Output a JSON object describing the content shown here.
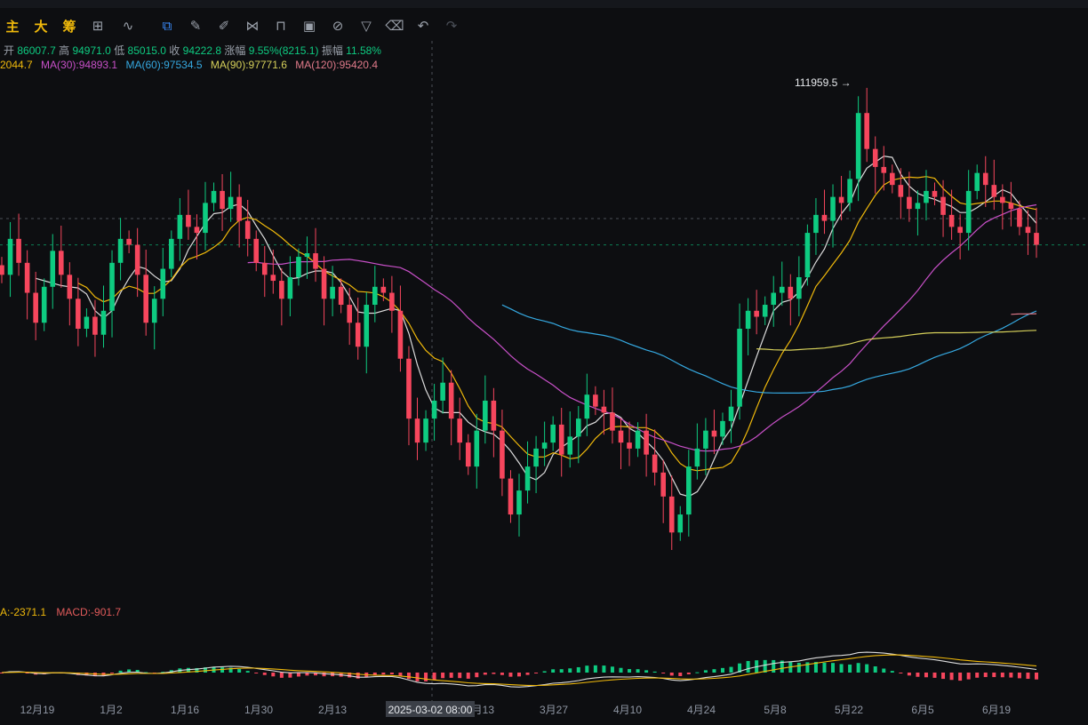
{
  "toolbar": {
    "chars": [
      "主",
      "大",
      "筹"
    ],
    "icons": [
      "candle-type-icon",
      "indicator-icon",
      "compare-icon",
      "draw-icon",
      "ruler-icon",
      "brush-icon",
      "pattern-icon",
      "lock-icon",
      "note-icon",
      "magnet-icon",
      "filter-icon",
      "trash-icon",
      "undo-icon",
      "redo-icon"
    ]
  },
  "ohlc": {
    "open_label": "开",
    "open": "86007.7",
    "high_label": "高",
    "high": "94971.0",
    "low_label": "低",
    "low": "85015.0",
    "close_label": "收",
    "close": "94222.8",
    "change_label": "涨幅",
    "change": "9.55%(8215.1)",
    "amp_label": "振幅",
    "amp": "11.58%"
  },
  "ma_legend": [
    {
      "text": "2044.7",
      "color": "#f0b90b"
    },
    {
      "text": "MA(30):94893.1",
      "color": "#c850c8"
    },
    {
      "text": "MA(60):97534.5",
      "color": "#35a8e0"
    },
    {
      "text": "MA(90):97771.6",
      "color": "#d6d05a"
    },
    {
      "text": "MA(120):95420.4",
      "color": "#e07a8a"
    }
  ],
  "macd_legend": [
    {
      "text": "A:-2371.1",
      "color": "#f0b90b"
    },
    {
      "text": "MACD:-901.7",
      "color": "#e05a5a"
    }
  ],
  "colors": {
    "up": "#0ecb81",
    "down": "#f6465d",
    "price_line": "#0ecb81"
  },
  "chart_data": {
    "type": "candlestick",
    "title": "",
    "x_labels": [
      "12月19",
      "1月2",
      "1月16",
      "1月30",
      "2月13",
      "2月27",
      "3月13",
      "3月27",
      "4月10",
      "4月24",
      "5月8",
      "5月22",
      "6月5",
      "6月19"
    ],
    "crosshair_label": "2025-03-02 08:00",
    "max_annotation": "111959.5",
    "ylim": [
      72000,
      115000
    ],
    "close_series": [
      98000,
      101000,
      99000,
      96500,
      94000,
      97000,
      100000,
      98000,
      96000,
      93500,
      94500,
      93000,
      95000,
      99000,
      101000,
      100500,
      98000,
      94000,
      96000,
      98500,
      101000,
      103000,
      102000,
      101500,
      104000,
      105000,
      103500,
      104500,
      102500,
      101000,
      99000,
      98000,
      97500,
      96000,
      97800,
      99500,
      99800,
      98500,
      96000,
      97000,
      95500,
      94000,
      92000,
      95500,
      97000,
      96500,
      95000,
      91000,
      86000,
      84000,
      86000,
      87500,
      89000,
      86000,
      84000,
      82000,
      85000,
      87500,
      85000,
      81000,
      78000,
      80000,
      82000,
      83500,
      84000,
      85500,
      83000,
      84500,
      86000,
      88000,
      87000,
      86500,
      85000,
      84000,
      83500,
      85000,
      83000,
      81500,
      79500,
      76500,
      78000,
      82000,
      83500,
      85000,
      84500,
      85800,
      87000,
      93500,
      95000,
      94500,
      95500,
      96500,
      97000,
      96000,
      97800,
      101500,
      103000,
      102500,
      104500,
      104000,
      106000,
      111500,
      108500,
      107000,
      106500,
      105500,
      104500,
      103500,
      104000,
      105000,
      104500,
      103000,
      102000,
      101500,
      105000,
      106500,
      105500,
      104500,
      104000,
      103500,
      102000,
      101500,
      100500
    ]
  }
}
